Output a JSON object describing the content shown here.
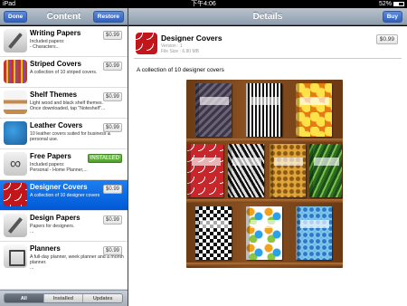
{
  "status": {
    "device": "iPad",
    "time": "下午4:06",
    "battery": "52%"
  },
  "left": {
    "title": "Content",
    "done_label": "Done",
    "restore_label": "Restore"
  },
  "right": {
    "title": "Details",
    "buy_label": "Buy"
  },
  "items": [
    {
      "name": "Writing Papers",
      "desc": "Included papers:\n- Characters...",
      "price": "$0.99",
      "icon": "pencil-paper-icon"
    },
    {
      "name": "Striped Covers",
      "desc": "A collection of 10 striped covers.",
      "price": "$0.99",
      "icon": "striped-cover-icon"
    },
    {
      "name": "Shelf Themes",
      "desc": "Light wood and black shelf themes.\nOnce downloaded, tap \"Noteshelf\"...",
      "price": "$0.99",
      "icon": "shelf-icon"
    },
    {
      "name": "Leather Covers",
      "desc": "10 leather covers suited for business & personal use.",
      "price": "$0.99",
      "icon": "leather-cover-icon"
    },
    {
      "name": "Free Papers",
      "desc": "Included papers:\nPersonal - Home Planner,...",
      "price": "INSTALLED",
      "icon": "infinity-icon"
    },
    {
      "name": "Designer Covers",
      "desc": "A collection of 10 designer covers",
      "price": "$0.99",
      "icon": "designer-cover-icon"
    },
    {
      "name": "Design Papers",
      "desc": "Papers for designers.\n...",
      "price": "$0.99",
      "icon": "pencil-paper-icon"
    },
    {
      "name": "Planners",
      "desc": "A full-day planner, week planner and a month planner.\n...",
      "price": "$0.99",
      "icon": "planner-icon"
    }
  ],
  "segments": [
    "All",
    "Installed",
    "Updates"
  ],
  "detail": {
    "title": "Designer Covers",
    "version": "Version : 1",
    "size": "File Size : 6.90 MB",
    "price": "$0.99",
    "description": "A collection of 10 designer covers"
  }
}
